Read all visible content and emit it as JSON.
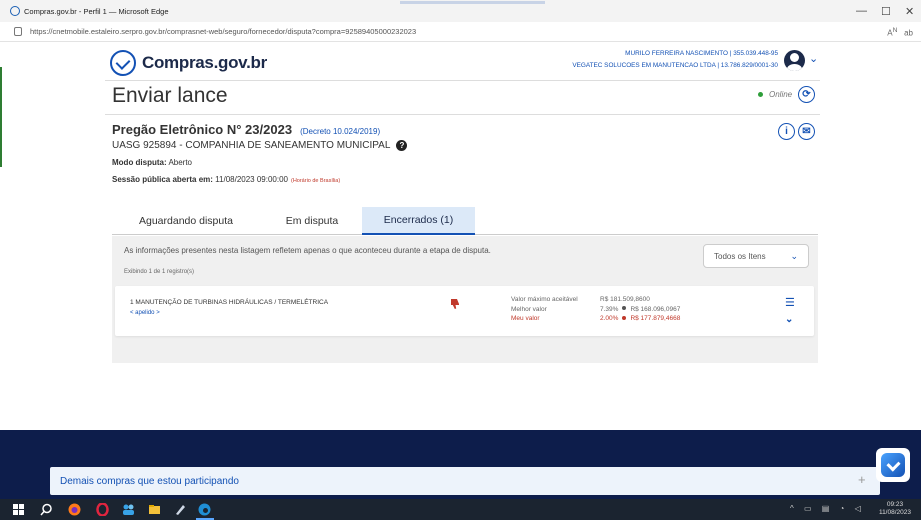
{
  "window": {
    "title": "Compras.gov.br - Perfil 1 — Microsoft Edge",
    "url": "https://cnetmobile.estaleiro.serpro.gov.br/comprasnet-web/seguro/fornecedor/disputa?compra=92589405000232023",
    "controls": [
      "—",
      "☐",
      "✕"
    ]
  },
  "header": {
    "logo": "Compras.gov.br",
    "user_name": "MURILO FERREIRA NASCIMENTO | 355.039.448-95",
    "company": "VEGATEC SOLUCOES EM MANUTENCAO LTDA | 13.786.829/0001-30",
    "chevron": "⌄"
  },
  "page": {
    "title": "Enviar lance",
    "status": "Online",
    "refresh": "⟳",
    "info_btn": "i",
    "mail_btn": "✉"
  },
  "pregao": {
    "title": "Pregão Eletrônico N° 23/2023",
    "decreto": "(Decreto 10.024/2019)",
    "uasg": "UASG 925894 - COMPANHIA DE SANEAMENTO MUNICIPAL",
    "help": "?",
    "modo_label": "Modo disputa:",
    "modo_value": "Aberto",
    "sessao_label": "Sessão pública aberta em:",
    "sessao_value": "11/08/2023 09:00:00",
    "horario": "(Horário de Brasília)"
  },
  "tabs": [
    {
      "label": "Aguardando disputa"
    },
    {
      "label": "Em disputa"
    },
    {
      "label": "Encerrados (1)"
    }
  ],
  "content": {
    "info": "As informações presentes nesta listagem refletem apenas o que aconteceu durante a etapa de disputa.",
    "showing": "Exibindo 1 de 1 registro(s)",
    "filter": "Todos os Itens",
    "filter_chevron": "⌄"
  },
  "item": {
    "title": "1  MANUTENÇÃO DE TURBINAS HIDRÁULICAS / TERMELÉTRICA",
    "alias": "< apelido >",
    "label_max": "Valor máximo aceitável",
    "label_best": "Melhor valor",
    "label_mine": "Meu valor",
    "max_value": "R$ 181.509,8600",
    "best_pct": "7.39%",
    "best_value": "R$ 168.096,0967",
    "mine_pct": "2.00%",
    "mine_value": "R$ 177.879,4668",
    "list_icon": "☰",
    "expand": "⌄"
  },
  "footer": {
    "demais": "Demais compras que estou participando",
    "plus": "+"
  },
  "taskbar": {
    "time": "09:23",
    "date": "11/08/2023",
    "tray": "^ ▭ ▤ ◔ ◁"
  }
}
